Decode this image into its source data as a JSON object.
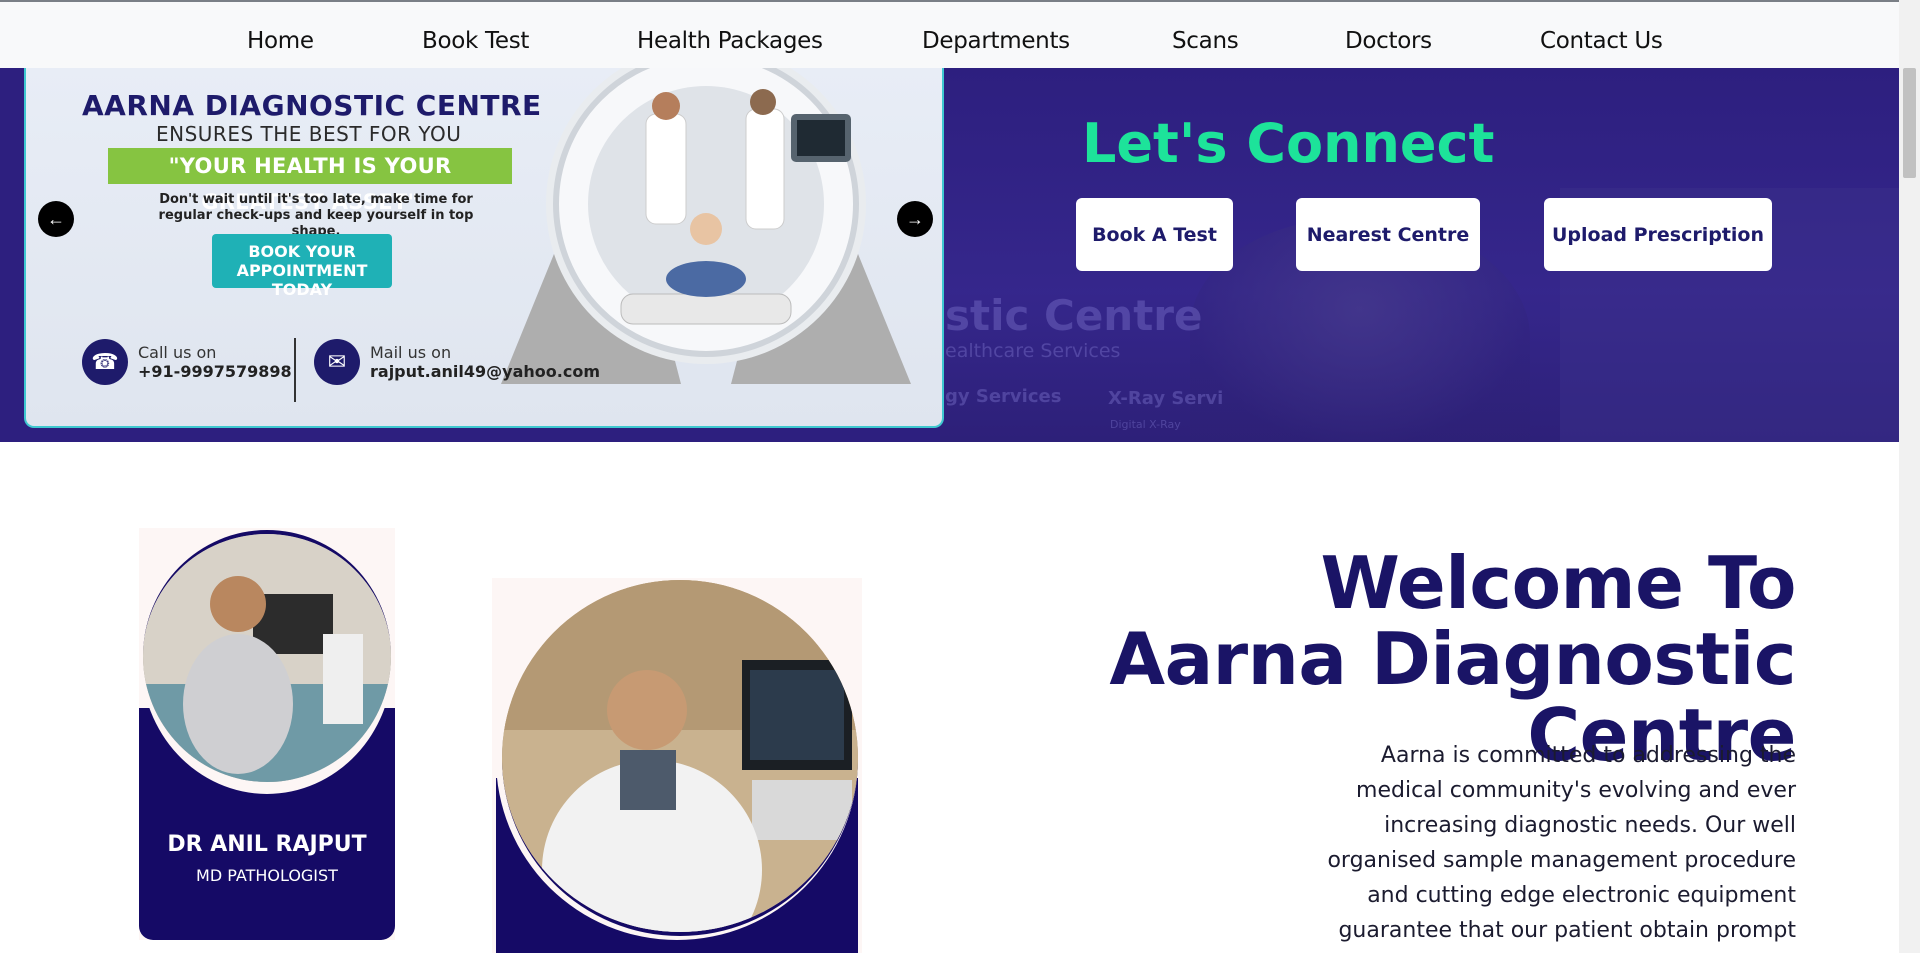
{
  "nav": {
    "items": [
      {
        "label": "Home"
      },
      {
        "label": "Book Test"
      },
      {
        "label": "Health Packages"
      },
      {
        "label": "Departments"
      },
      {
        "label": "Scans"
      },
      {
        "label": "Doctors"
      },
      {
        "label": "Contact Us"
      }
    ]
  },
  "hero": {
    "banner": {
      "title": "AARNA DIAGNOSTIC CENTRE",
      "subtitle": "ENSURES THE BEST FOR YOU",
      "tagline": "\"YOUR HEALTH IS YOUR GREATEST ASSET\"",
      "text": "Don't wait until it's too late, make time for regular check-ups and keep yourself in top shape.",
      "cta": "BOOK YOUR APPOINTMENT TODAY",
      "call_label": "Call us on",
      "call_value": "+91-9997579898",
      "mail_label": "Mail us on",
      "mail_value": "rajput.anil49@yahoo.com"
    },
    "connect_title": "Let's Connect",
    "buttons": {
      "book": "Book A Test",
      "nearest": "Nearest Centre",
      "upload": "Upload Prescription"
    },
    "background_sign": {
      "line1": "stic Centre",
      "line2": "ealthcare Services",
      "line3": "gy Services",
      "line4": "X-Ray Servi",
      "line5": "Digital X-Ray"
    }
  },
  "welcome": {
    "title": "Welcome To Aarna Diagnostic Centre",
    "text": "Aarna is committed to addressing the medical community's evolving and ever increasing diagnostic needs. Our well organised sample management procedure and cutting edge electronic equipment guarantee that our patient obtain prompt and reliable result. The aim of"
  },
  "doctors": [
    {
      "name": "DR ANIL RAJPUT",
      "role": "MD PATHOLOGIST"
    }
  ],
  "colors": {
    "brand_navy": "#1a1466",
    "hero_bg": "#2d1f7f",
    "connect_green": "#1de39a",
    "banner_green": "#86c441",
    "banner_teal": "#1fb1b6"
  }
}
